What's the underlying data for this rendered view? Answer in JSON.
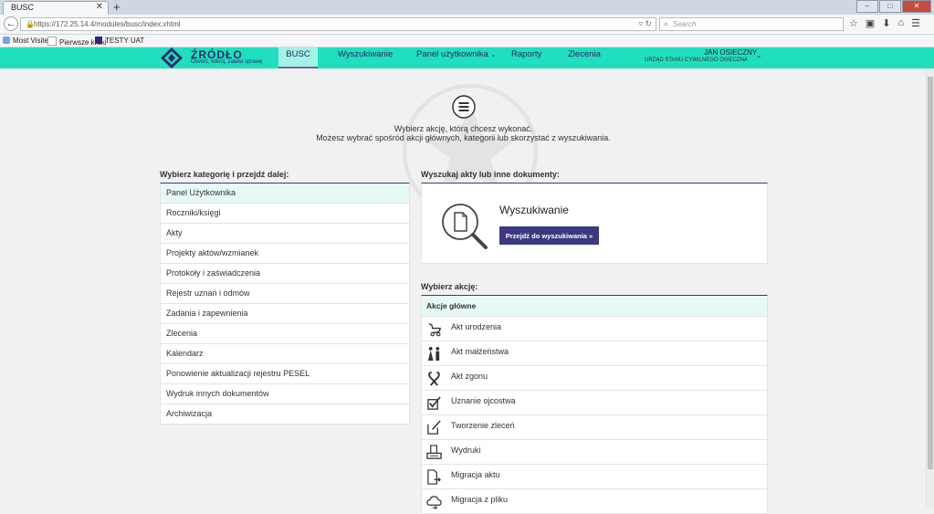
{
  "browser": {
    "tab_title": "BUSC",
    "url": "https://172.25.14.4/modules/busc/index.xhtml",
    "search_placeholder": "Search",
    "bookmarks": [
      "Most Visited",
      "Pierwsze kroki",
      "TESTY UAT"
    ]
  },
  "app": {
    "logo_title": "ŹRÓDŁO",
    "logo_subtitle": "Otwórz, kliknij, załatw sprawę",
    "nav": [
      {
        "label": "BUSC",
        "active": true
      },
      {
        "label": "Wyszukiwanie",
        "active": false
      },
      {
        "label": "Panel użytkownika",
        "active": false
      },
      {
        "label": "Raporty",
        "active": false
      },
      {
        "label": "Zlecenia",
        "active": false
      }
    ],
    "user_name": "JAN OSIECZNY",
    "user_office": "URZĄD STANU CYWILNEGO OSIECZNA"
  },
  "intro": {
    "line1": "Wybierz akcję, którą chcesz wykonać.",
    "line2": "Możesz wybrać spośród akcji głównych, kategorii lub skorzystać z wyszukiwania."
  },
  "categories": {
    "title": "Wybierz kategorię i przejdź dalej:",
    "items": [
      "Panel Użytkownika",
      "Roczniki/księgi",
      "Akty",
      "Projekty aktów/wzmianek",
      "Protokoły i zaświadczenia",
      "Rejestr uznań i odmów",
      "Zadania i zapewnienia",
      "Zlecenia",
      "Kalendarz",
      "Ponowienie aktualizacji rejestru PESEL",
      "Wydruk innych dokumentów",
      "Archiwizacja"
    ]
  },
  "search": {
    "title": "Wyszukaj akty lub inne dokumenty:",
    "heading": "Wyszukiwanie",
    "button": "Przejdź do wyszukiwania »"
  },
  "actions": {
    "title": "Wybierz akcję:",
    "header": "Akcje główne",
    "items": [
      {
        "label": "Akt urodzenia",
        "icon": "stroller-icon"
      },
      {
        "label": "Akt małżeństwa",
        "icon": "couple-icon"
      },
      {
        "label": "Akt zgonu",
        "icon": "ribbon-icon"
      },
      {
        "label": "Uznanie ojcostwa",
        "icon": "checkbox-icon"
      },
      {
        "label": "Tworzenie zleceń",
        "icon": "edit-icon"
      },
      {
        "label": "Wydruki",
        "icon": "printer-icon"
      },
      {
        "label": "Migracja aktu",
        "icon": "document-arrow-icon"
      },
      {
        "label": "Migracja z pliku",
        "icon": "cloud-icon"
      }
    ]
  },
  "colors": {
    "header_bg": "#1fdfbe",
    "active_tab_bg": "#a4f2e4",
    "accent": "#3a3a80",
    "list_highlight": "#e6f9f6"
  }
}
